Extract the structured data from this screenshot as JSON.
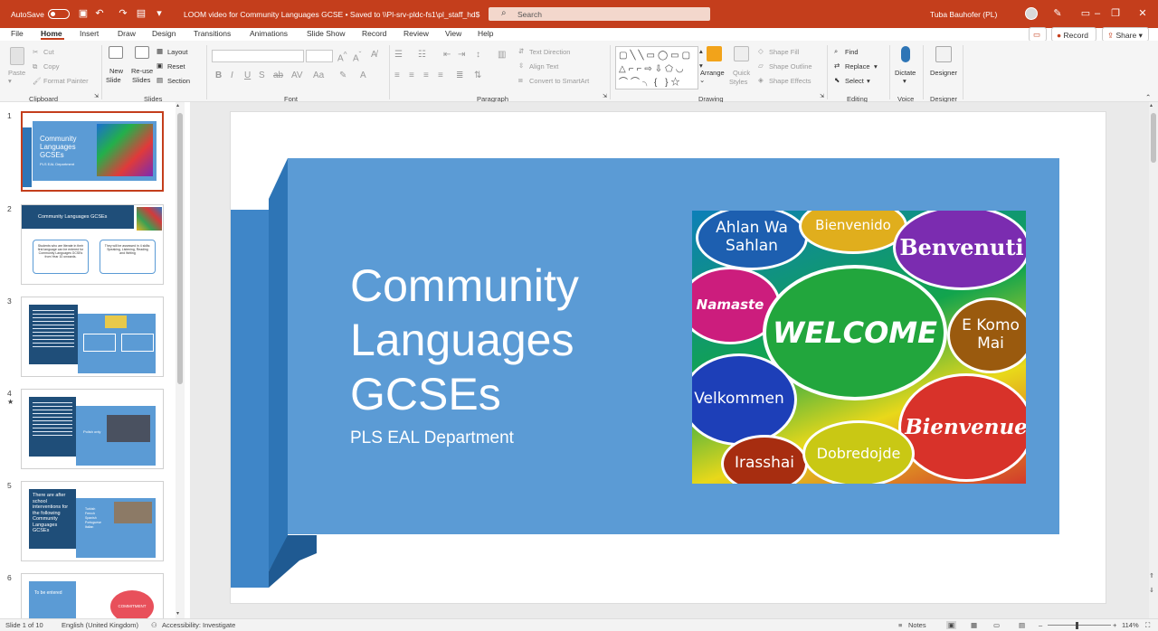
{
  "titlebar": {
    "autosave_label": "AutoSave",
    "autosave_state": "Off",
    "document_title": "LOOM video for Community Languages GCSE  •  Saved to \\\\Pl-srv-pldc-fs1\\pl_staff_hd$",
    "search_placeholder": "Search",
    "user_name": "Tuba Bauhofer (PL)"
  },
  "menu": {
    "tabs": [
      "File",
      "Home",
      "Insert",
      "Draw",
      "Design",
      "Transitions",
      "Animations",
      "Slide Show",
      "Record",
      "Review",
      "View",
      "Help"
    ],
    "active_tab": "Home",
    "record_button": "Record",
    "share_button": "Share"
  },
  "ribbon": {
    "clipboard": {
      "paste": "Paste",
      "cut": "Cut",
      "copy": "Copy",
      "format_painter": "Format Painter",
      "label": "Clipboard"
    },
    "slides": {
      "new_slide_1": "New",
      "new_slide_2": "Slide",
      "reuse_1": "Re-use",
      "reuse_2": "Slides",
      "layout": "Layout",
      "reset": "Reset",
      "section": "Section",
      "label": "Slides"
    },
    "font": {
      "label": "Font"
    },
    "paragraph": {
      "text_direction": "Text Direction",
      "align_text": "Align Text",
      "convert_smartart": "Convert to SmartArt",
      "label": "Paragraph"
    },
    "drawing": {
      "arrange": "Arrange",
      "quick_styles_1": "Quick",
      "quick_styles_2": "Styles",
      "shape_fill": "Shape Fill",
      "shape_outline": "Shape Outline",
      "shape_effects": "Shape Effects",
      "label": "Drawing"
    },
    "editing": {
      "find": "Find",
      "replace": "Replace",
      "select": "Select",
      "label": "Editing"
    },
    "voice": {
      "dictate": "Dictate",
      "label": "Voice"
    },
    "designer": {
      "designer": "Designer",
      "label": "Designer"
    }
  },
  "thumbnails": {
    "numbers": [
      "1",
      "2",
      "3",
      "4",
      "5",
      "6"
    ],
    "star": "★",
    "t1_title": "Community Languages GCSEs",
    "t1_sub": "PLS EAL Department",
    "t2_title": "Community Languages GCSEs",
    "t2_box1": "Students who are literate in their first language can be entered for Community Languages GCSEs from Year 10 onwards.",
    "t2_box2": "They will be assessed in 4 skills: Speaking, Listening, Reading and Writing",
    "t4_bullet": "Polish only",
    "t5_title": "There are after school interventions for the following Community Languages GCSEs",
    "t5_items": [
      "Turkish",
      "French",
      "Spanish",
      "Portuguese",
      "Italian"
    ],
    "t6_title": "To be entered",
    "t6_img": "COMMITMENT"
  },
  "slide": {
    "title_lines": [
      "Community",
      "Languages",
      "GCSEs"
    ],
    "subtitle": "PLS EAL Department",
    "bubbles": {
      "ahlan": "Ahlan Wa Sahlan",
      "bienvenido": "Bienvenido",
      "benvenuti": "Benvenuti",
      "namaste": "Namaste",
      "welcome": "WELCOME",
      "ekomo": "E Komo Mai",
      "velkommen": "Velkommen",
      "bienvenue": "Bienvenue",
      "irasshai": "Irasshai",
      "dobredojde": "Dobredojde"
    },
    "colors": {
      "primary": "#5b9bd5",
      "dark": "#2e75b6",
      "darker": "#1f4e79"
    }
  },
  "statusbar": {
    "slide_counter": "Slide 1 of 10",
    "language": "English (United Kingdom)",
    "accessibility": "Accessibility: Investigate",
    "notes": "Notes",
    "zoom": "114%"
  }
}
